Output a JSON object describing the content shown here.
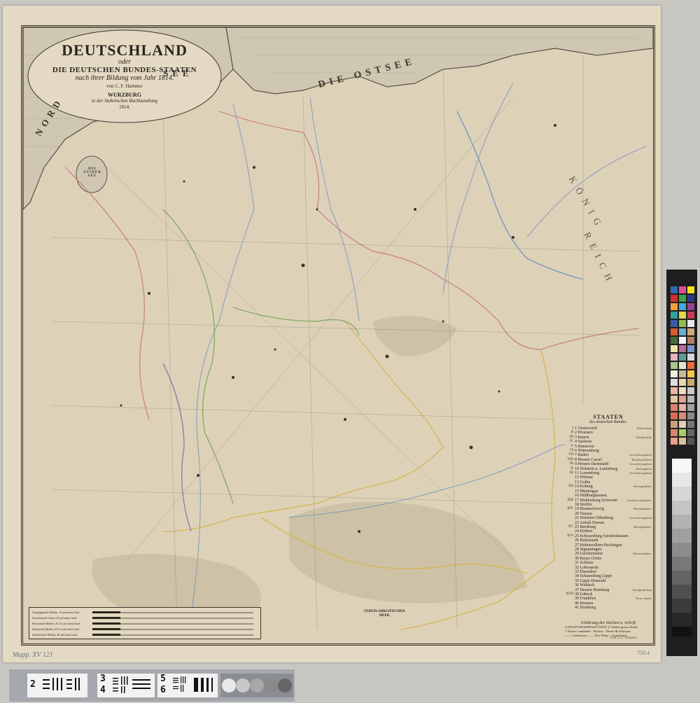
{
  "map": {
    "title": "DEUTSCHLAND",
    "subtitle_connector": "oder",
    "subtitle": "DIE DEUTSCHEN BUNDES-STAATEN",
    "subtitle_line2": "nach ihrer Bildung vom Jahr 1814.",
    "author": "von C. F. Hammer",
    "publisher_city": "WURZBURG",
    "publisher": "in der Stahelschen Buchhandlung",
    "year": "1814.",
    "sea_north": "NORD SEE",
    "sea_north_1": "NORD",
    "sea_north_2": "SEE",
    "sea_east": "DIE OSTSEE",
    "lake": "DIE ZUIDER SEE",
    "region_koenig": "KÖNIG",
    "region_reich": "REICH",
    "engraver": "Gest. v. C. Geissler.",
    "verein_label": "VEREIN ADRIATISCHEN MEER"
  },
  "legend": {
    "title": "STAATEN",
    "subtitle": "des deutschen Bundes.",
    "rows": [
      {
        "num": "I",
        "name": "1 Oesterreich",
        "cat": "Kaiserthum"
      },
      {
        "num": "II",
        "name": "2 Preussen",
        "cat": ""
      },
      {
        "num": "III",
        "name": "3 Baiern",
        "cat": "Königreiche"
      },
      {
        "num": "IV",
        "name": "4 Sachsen",
        "cat": ""
      },
      {
        "num": "V",
        "name": "5 Hannover",
        "cat": ""
      },
      {
        "num": "VI",
        "name": "6 Würtemberg",
        "cat": ""
      },
      {
        "num": "VII",
        "name": "7 Baden",
        "cat": "Grossherzogthum"
      },
      {
        "num": "VIII",
        "name": "8 Hessen Cassel",
        "cat": "Kurfürstenthum"
      },
      {
        "num": "IX",
        "name": "9 Hessen Darmstadt",
        "cat": "Grossherzogthum"
      },
      {
        "num": "X",
        "name": "10 Holstein u. Lauenburg",
        "cat": "Herzogthum"
      },
      {
        "num": "XI",
        "name": "11 Luxemburg",
        "cat": "Grossherzogthum"
      },
      {
        "num": "",
        "name": "12 Weimar",
        "cat": ""
      },
      {
        "num": "",
        "name": "13 Gotha",
        "cat": ""
      },
      {
        "num": "XII",
        "name": "14 Koburg",
        "cat": "Herzogthümer"
      },
      {
        "num": "",
        "name": "15 Meiningen",
        "cat": ""
      },
      {
        "num": "",
        "name": "16 Hildburghausen",
        "cat": ""
      },
      {
        "num": "XIII",
        "name": "17 Meklenburg Schwerin",
        "cat": "Grossherzogthümer"
      },
      {
        "num": "",
        "name": "18 Strelitz",
        "cat": ""
      },
      {
        "num": "XIV",
        "name": "19 Braunschweig",
        "cat": "Herzogthümer"
      },
      {
        "num": "",
        "name": "20 Nassau",
        "cat": ""
      },
      {
        "num": "",
        "name": "21 Holstein Oldenburg",
        "cat": "Grossherzogthum"
      },
      {
        "num": "",
        "name": "22 Anhalt Dessau",
        "cat": ""
      },
      {
        "num": "XV",
        "name": "23 Bernburg",
        "cat": "Herzogthümer"
      },
      {
        "num": "",
        "name": "24 Köthen",
        "cat": ""
      },
      {
        "num": "XVI",
        "name": "25 Schwarzburg Sondershausen",
        "cat": ""
      },
      {
        "num": "",
        "name": "26 Rudolstadt",
        "cat": ""
      },
      {
        "num": "",
        "name": "27 Hohenzollern Hechingen",
        "cat": ""
      },
      {
        "num": "",
        "name": "28 Sigmaringen",
        "cat": ""
      },
      {
        "num": "",
        "name": "29 Liechtenstein",
        "cat": "Fürstenthümer"
      },
      {
        "num": "",
        "name": "30 Reuss Greitz",
        "cat": ""
      },
      {
        "num": "",
        "name": "31 Schleitz",
        "cat": ""
      },
      {
        "num": "",
        "name": "32 Lobenstein",
        "cat": ""
      },
      {
        "num": "",
        "name": "33 Ebersdorf",
        "cat": ""
      },
      {
        "num": "",
        "name": "34 Schaumburg Lippe",
        "cat": ""
      },
      {
        "num": "",
        "name": "35 Lippe Detmold",
        "cat": ""
      },
      {
        "num": "",
        "name": "36 Waldeck",
        "cat": ""
      },
      {
        "num": "",
        "name": "37 Hessen Homburg",
        "cat": "Landgrafschaft"
      },
      {
        "num": "XVII",
        "name": "38 Lübeck",
        "cat": ""
      },
      {
        "num": "",
        "name": "39 Frankfurt",
        "cat": "Freye Städte"
      },
      {
        "num": "",
        "name": "40 Bremen",
        "cat": ""
      },
      {
        "num": "",
        "name": "41 Hamburg",
        "cat": ""
      }
    ],
    "footer_title": "Erklärung der Zeichen u. Schrift",
    "footer_lines": [
      "⊙ HAUPT-RESIDENZSTÄDTE  ⊙ Andere grosse Städte",
      "○ Kleine Landstädte  · Flecken  · Dörfer  ⊕ Schlösser",
      "—— Landstrasse  —— Post-Wege  ·· Gränzlinien"
    ]
  },
  "scale": {
    "rows": [
      "Geographische Meilen, 15 auf einen Grad.",
      "Französische Lieues, 25 auf einen Grad.",
      "Preussische Meilen, 23 1/2 auf einen Grad.",
      "Sächsische Meilen, 23 1/3 auf einen Grad.",
      "Französische Meilen, 20 auf einen Grad."
    ]
  },
  "marks": {
    "left_stamp": "Mapp. XV 121",
    "right_stamp": "756.4"
  },
  "target_card": {
    "cells": [
      "2",
      "3",
      "4",
      "5",
      "6"
    ]
  },
  "colors": {
    "paper": "#e4dac4",
    "map_bg": "#ddd2b8",
    "ink": "#2a251d",
    "border_pink": "#c97a8a",
    "border_green": "#7aa55a",
    "border_blue": "#6c8fbf",
    "border_yellow": "#d7b24a",
    "border_violet": "#8e6aa8",
    "sea": "#cfc7b1"
  }
}
